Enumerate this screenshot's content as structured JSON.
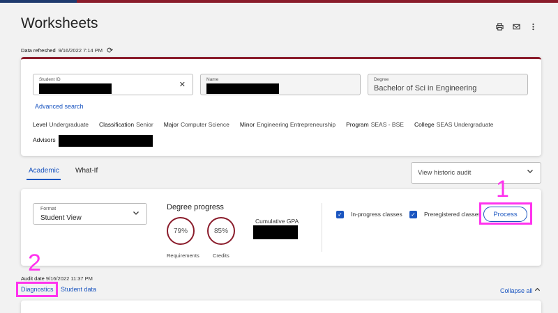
{
  "page": {
    "title": "Worksheets"
  },
  "toolbar": {
    "print_icon": "print-icon",
    "email_icon": "email-icon",
    "more_icon": "more-vertical-icon"
  },
  "refresh": {
    "label": "Data refreshed",
    "timestamp": "9/16/2022 7:14 PM"
  },
  "student": {
    "id_label": "Student ID",
    "name_label": "Name",
    "degree_label": "Degree",
    "degree_value": "Bachelor of Sci in Engineering",
    "advanced_search": "Advanced search",
    "meta": [
      {
        "key": "Level",
        "value": "Undergraduate"
      },
      {
        "key": "Classification",
        "value": "Senior"
      },
      {
        "key": "Major",
        "value": "Computer Science"
      },
      {
        "key": "Minor",
        "value": "Engineering Entrepreneurship"
      },
      {
        "key": "Program",
        "value": "SEAS - BSE"
      },
      {
        "key": "College",
        "value": "SEAS Undergraduate"
      }
    ],
    "advisors_label": "Advisors"
  },
  "tabs": [
    {
      "label": "Academic"
    },
    {
      "label": "What-If"
    }
  ],
  "historic": {
    "placeholder": "View historic audit"
  },
  "progress": {
    "format_label": "Format",
    "format_value": "Student View",
    "title": "Degree progress",
    "requirements_percent": "79%",
    "requirements_label": "Requirements",
    "credits_percent": "85%",
    "credits_label": "Credits",
    "gpa_label": "Cumulative GPA",
    "inprogress_label": "In-progress classes",
    "preregistered_label": "Preregistered classes",
    "process_label": "Process"
  },
  "annotations": {
    "one": "1",
    "two": "2"
  },
  "audit": {
    "label": "Audit date",
    "timestamp": "9/16/2022 11:37 PM",
    "diagnostics": "Diagnostics",
    "student_data": "Student data",
    "collapse_all": "Collapse all"
  },
  "colors": {
    "accent": "#1a55c0",
    "brand": "#8a1c2b",
    "highlight": "#ff33ee"
  }
}
